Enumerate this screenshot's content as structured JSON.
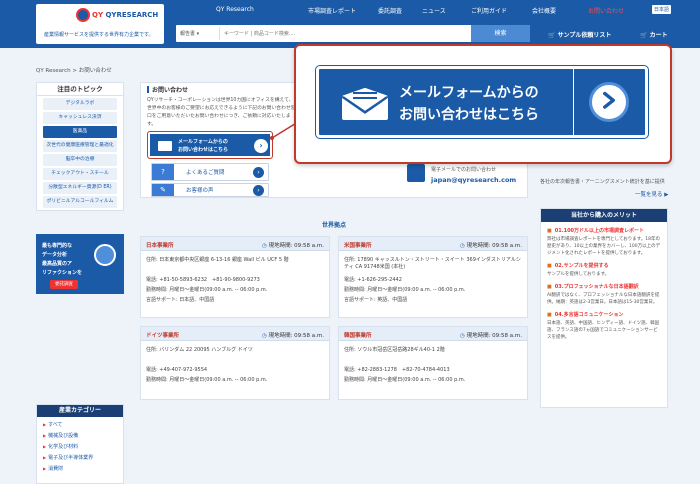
{
  "header": {
    "logo_text": "QYRESEARCH",
    "logo_qy": "QY",
    "tagline": "産業情報サービスを提供する世界有力企業です。",
    "nav": [
      "QY Research",
      "市場調査レポート",
      "委託調査",
      "ニュース",
      "ご利用ガイド",
      "会社概要",
      "お問い合わせ"
    ],
    "lang": "日本語",
    "search": {
      "category": "報告書",
      "placeholder": "キーワード | 商品コード検索....",
      "button": "検索"
    },
    "sample_request": "サンプル依頼リスト",
    "cart": "カート"
  },
  "breadcrumb": "QY Research > お問い合わせ",
  "sidebar": {
    "title": "注目のトピック",
    "items": [
      "デジタルラボ",
      "キャッシュレス決済",
      "医薬品",
      "次世代の健康医療管理と最適化",
      "脳卒中の治療",
      "チェックアウト・スチール",
      "分散型エネルギー資源(D ER)",
      "ポリビニルアルコールフィルム"
    ],
    "active_index": 2,
    "banner": {
      "lines": [
        "最も専門的な",
        "データ分析",
        "最高品質のア",
        "リファクションを"
      ],
      "button": "委託調査"
    },
    "category_title": "産業カテゴリー",
    "categories": [
      "すべて",
      "機械及び設備",
      "化学及び材料",
      "電子及び半導体業界",
      "消費財"
    ]
  },
  "main": {
    "heading": "お問い合わせ",
    "intro": "QYリサーチ・コーポレーションは世界10カ国にオフィスを構えて、世界中のお客様のご要望にお応えできるように下記のお問い合わせ窓口をご用意いただいたお問い合わせにつき、ご依頼に対応いたします。",
    "mail_button": [
      "メールフォームからの",
      "お問い合わせはこちら"
    ],
    "faq_button": "よくあるご質問",
    "voice_button": "お客様の声",
    "email_label": "電子メールでのお問い合わせ",
    "email": "japan@qyresearch.com"
  },
  "callout": {
    "line1": "メールフォームからの",
    "line2": "お問い合わせはこちら"
  },
  "offices_title": "世界拠点",
  "offices": [
    {
      "name": "日本事業所",
      "time": "現地時間: 09:58 a.m.",
      "lines": [
        "住所: 日本東京都中央区銀座 6-13-16 銀座 Wall ビル UCF 5 階",
        "",
        "電話: +81-50-5893-6232　+81-90-9800-9273",
        "勤務時間: 月曜日〜金曜日(09:00 a.m. -- 06:00 p.m.",
        "言語サポート: 日本語、中国語"
      ]
    },
    {
      "name": "米国事業所",
      "time": "現地時間: 09:58 a.m.",
      "lines": [
        "住所: 17890 キャッスルトン・ストリート・スイート 369インダストリアルシティ CA 91748米国 (本社)",
        "",
        "電話: +1-626-295-2442",
        "勤務時間: 月曜日〜金曜日(09:00 a.m. -- 06:00 p.m.",
        "言語サポート: 英語、中国語"
      ]
    },
    {
      "name": "ドイツ事業所",
      "time": "現地時間: 09:58 a.m.",
      "lines": [
        "住所: バリンダム 22 20095 ハンブルグ ドイツ",
        "",
        "電話: +49-407-972-9554",
        "勤務時間: 月曜日〜金曜日(09:00 a.m. -- 06:00 p.m."
      ]
    },
    {
      "name": "韓国事業所",
      "time": "現地時間: 09:58 a.m.",
      "lines": [
        "住所: ソウル市冠岳区冠岳路28ギル40-1 2階",
        "",
        "電話: +82-2883-1278　+82-70-4784-4013",
        "勤務時間: 月曜日〜金曜日(09:00 a.m. -- 06:00 p.m."
      ]
    }
  ],
  "right_rail": {
    "news_snippet": "各社の年次報告書・アーニングスメント統計を基に提供",
    "more": "一覧を見る ▶",
    "merit_title": "当社から購入のメリット",
    "merits": [
      {
        "title": "01.100万ドル以上の市場調査レポート",
        "body": "弊社は市場調査レポートを専門としております。18年の歴史があり、10以上の業界をカバーし、100万以上のデジメント化されたレポートを提供しております。"
      },
      {
        "title": "02.サンプルを提供する",
        "body": "サンプルを提供しております。"
      },
      {
        "title": "03.プロフェッショナルな日本語翻訳",
        "body": "AI翻訳ではなく、プロフェッショナルな日本語翻訳を提供。納期：英語は2-3営業日。日本語は15-30営業日。"
      },
      {
        "title": "04.多言語コミュニケーション",
        "body": "日本語、英語、中国語、ヒンディー語、ドイツ語、韓国語、フランス語の7ヵ国語でコミュニケーションサービスを提供。"
      }
    ]
  },
  "colors": {
    "brand": "#1b5aa6",
    "accent": "#c0392b",
    "background": "#eef3f9"
  }
}
